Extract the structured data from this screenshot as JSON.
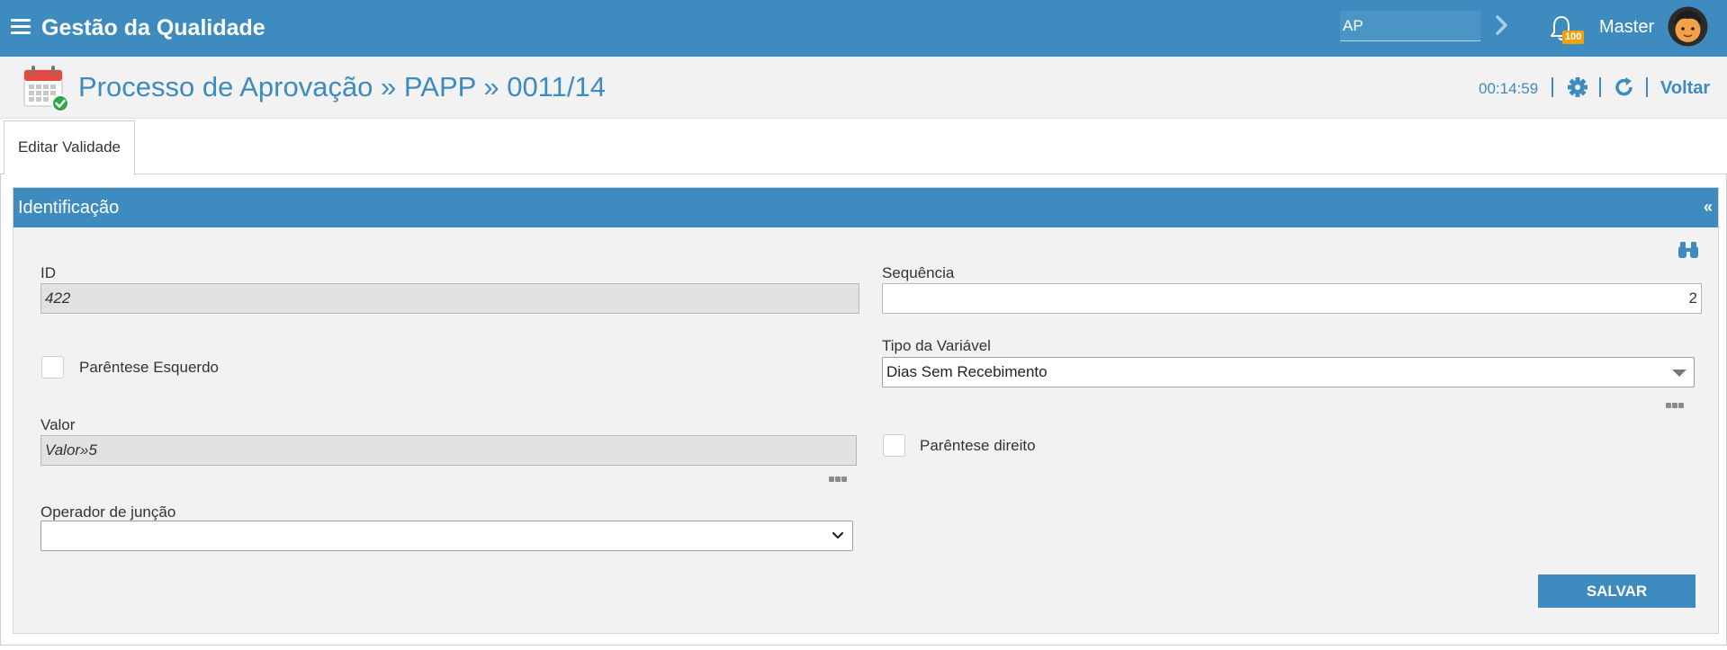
{
  "topbar": {
    "app_title": "Gestão da Qualidade",
    "search_value": "AP",
    "notification_count": "100",
    "user_name": "Master"
  },
  "header": {
    "title": "Processo de Aprovação » PAPP » 0011/14",
    "timer": "00:14:59",
    "back_label": "Voltar"
  },
  "tabs": [
    {
      "label": "Editar Validade"
    }
  ],
  "panel": {
    "title": "Identificação",
    "collapse_symbol": "«"
  },
  "form": {
    "id_label": "ID",
    "id_value": "422",
    "sequencia_label": "Sequência",
    "sequencia_value": "2",
    "parentese_esquerdo_label": "Parêntese Esquerdo",
    "tipo_variavel_label": "Tipo da Variável",
    "tipo_variavel_value": "Dias Sem Recebimento",
    "valor_label": "Valor",
    "valor_value": "Valor»5",
    "parentese_direito_label": "Parêntese direito",
    "operador_label": "Operador de junção",
    "operador_value": "",
    "save_label": "SALVAR"
  },
  "colors": {
    "primary": "#3d8bbf",
    "badge": "#f0a30a",
    "panel_bg": "#f2f2f2",
    "readonly_bg": "#e2e2e2"
  },
  "icons": {
    "menu": "hamburger-icon",
    "search_go": "chevron-right-icon",
    "notifications": "bell-icon",
    "user": "avatar",
    "module": "calendar-check-icon",
    "settings": "gear-icon",
    "refresh": "refresh-icon",
    "search_lookup": "binoculars-icon",
    "more": "ellipsis-icon"
  }
}
